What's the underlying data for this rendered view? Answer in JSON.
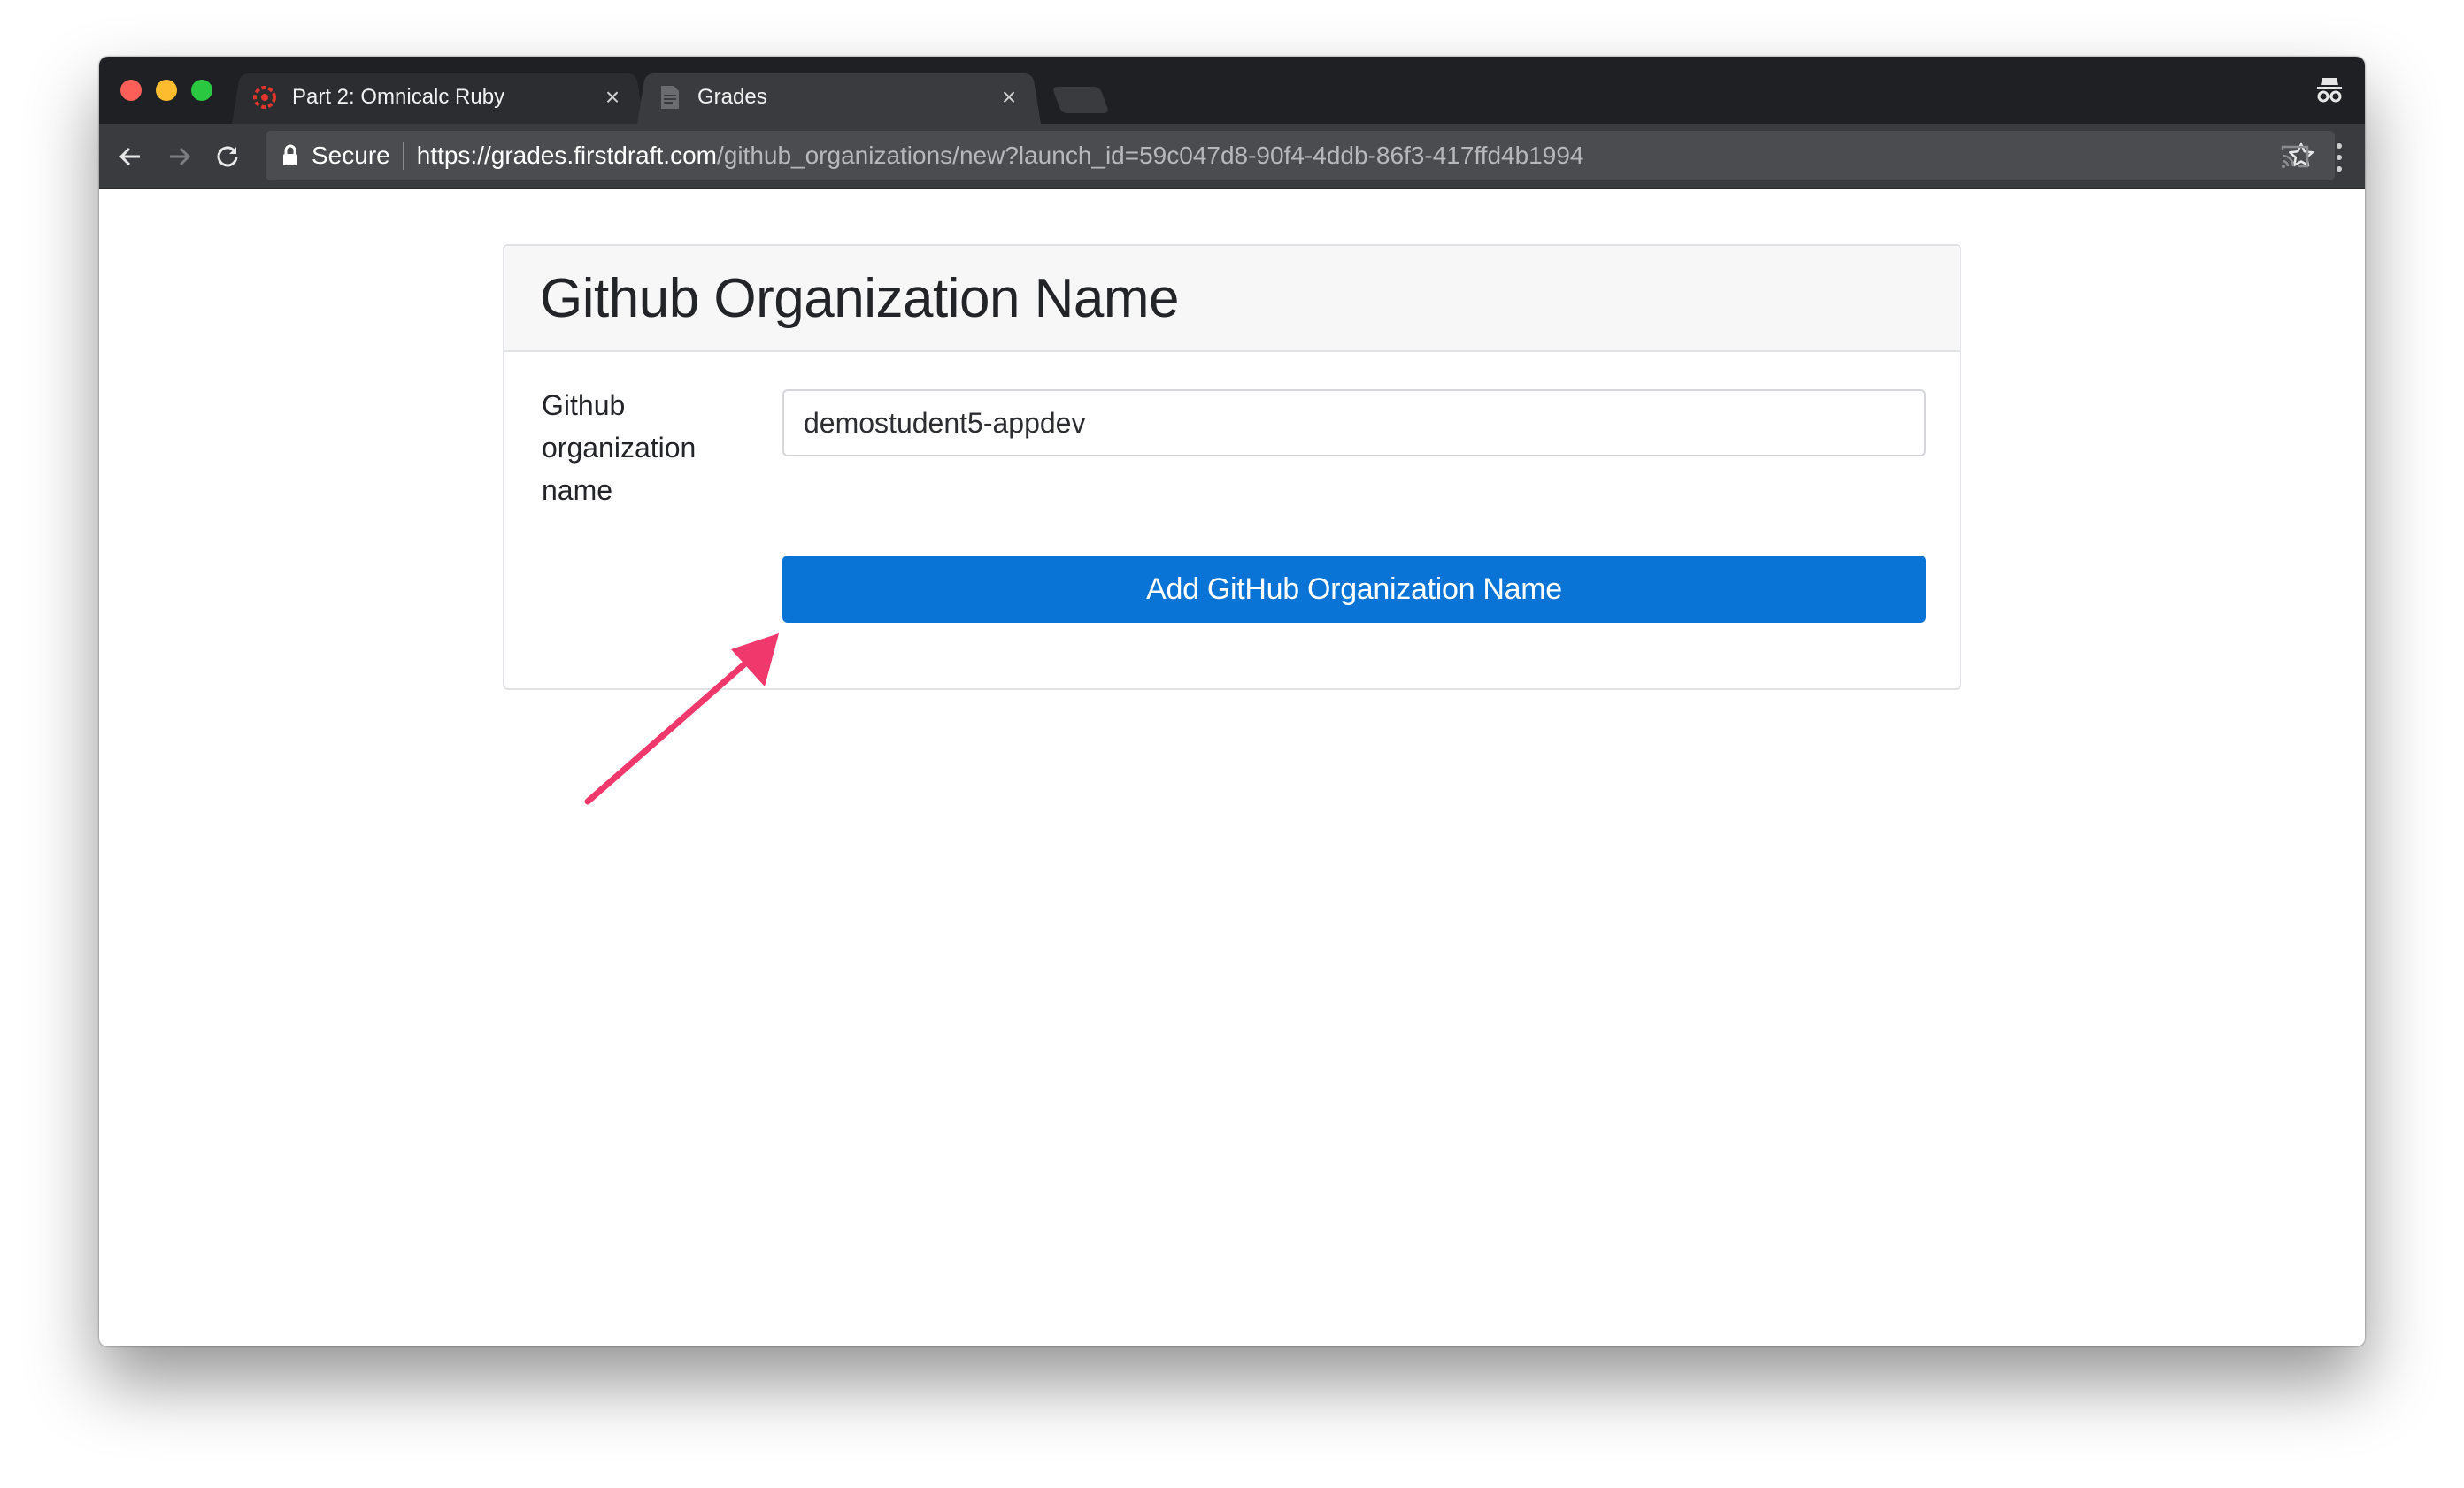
{
  "browser": {
    "tabs": [
      {
        "title": "Part 2: Omnicalc Ruby",
        "favicon": "settings-gear-red-icon",
        "active": false
      },
      {
        "title": "Grades",
        "favicon": "document-icon",
        "active": true
      }
    ],
    "close_glyph": "×",
    "address_bar": {
      "security_label": "Secure",
      "url_host": "https://grades.firstdraft.com",
      "url_path": "/github_organizations/new?launch_id=59c047d8-90f4-4ddb-86f3-417ffd4b1994"
    }
  },
  "page": {
    "card_title": "Github Organization Name",
    "form": {
      "label": "Github organization name",
      "input_value": "demostudent5-appdev",
      "submit_label": "Add GitHub Organization Name"
    }
  },
  "colors": {
    "accent": "#0a74d6",
    "annotation_arrow": "#f0386c"
  }
}
